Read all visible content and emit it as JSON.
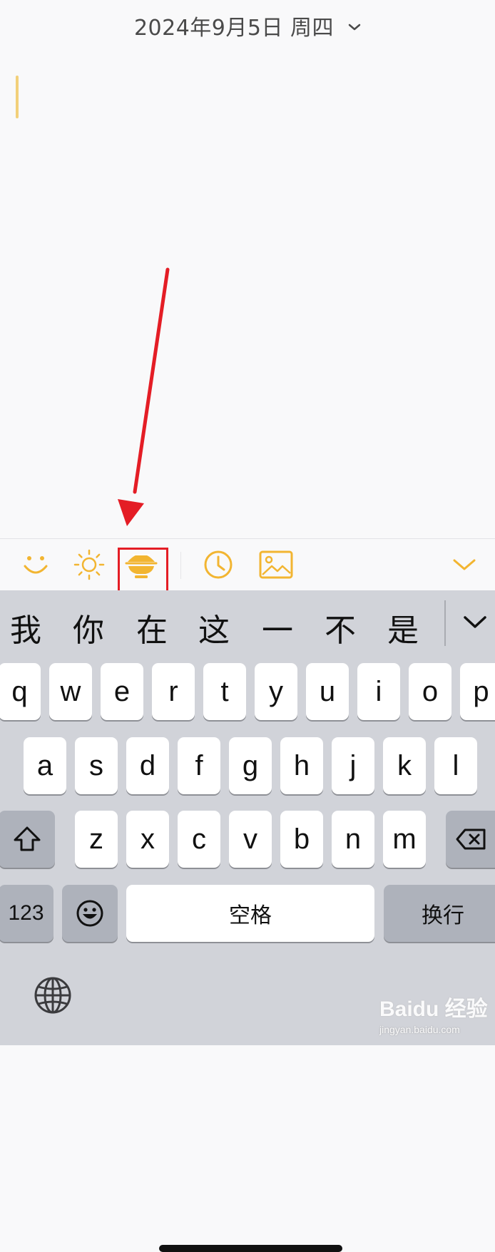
{
  "header": {
    "date": "2024年9月5日 周四"
  },
  "toolbar": {
    "icons": [
      "smiley-icon",
      "sun-icon",
      "bowl-icon",
      "clock-icon",
      "image-icon",
      "collapse-chevron-icon"
    ],
    "accent_color": "#f2b531",
    "highlight_color": "#e41d25"
  },
  "keyboard": {
    "candidates": [
      "我",
      "你",
      "在",
      "这",
      "一",
      "不",
      "是"
    ],
    "row1": [
      "q",
      "w",
      "e",
      "r",
      "t",
      "y",
      "u",
      "i",
      "o",
      "p"
    ],
    "row2": [
      "a",
      "s",
      "d",
      "f",
      "g",
      "h",
      "j",
      "k",
      "l"
    ],
    "row3": [
      "z",
      "x",
      "c",
      "v",
      "b",
      "n",
      "m"
    ],
    "numbers_key": "123",
    "space_key": "空格",
    "return_key": "换行"
  },
  "watermark": {
    "main": "Baidu 经验",
    "sub": "jingyan.baidu.com"
  }
}
